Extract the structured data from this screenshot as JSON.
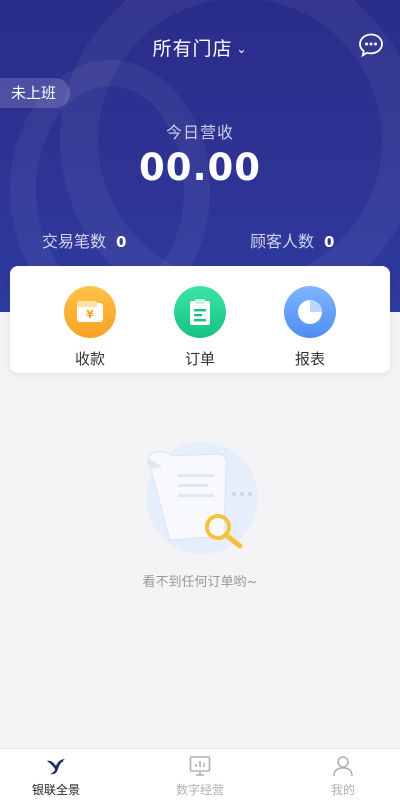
{
  "header": {
    "store_selector": "所有门店",
    "status_badge": "未上班",
    "revenue_label": "今日营收",
    "revenue_value": "00.00",
    "transactions_label": "交易笔数",
    "transactions_value": "0",
    "customers_label": "顾客人数",
    "customers_value": "0"
  },
  "actions": [
    {
      "label": "收款",
      "icon": "wallet-yen-icon"
    },
    {
      "label": "订单",
      "icon": "clipboard-icon"
    },
    {
      "label": "报表",
      "icon": "pie-chart-icon"
    }
  ],
  "empty_state": {
    "message": "看不到任何订单哟~"
  },
  "tabbar": [
    {
      "label": "银联全景",
      "icon": "unionpay-bird-icon",
      "active": true
    },
    {
      "label": "数字经营",
      "icon": "monitor-chart-icon",
      "active": false
    },
    {
      "label": "我的",
      "icon": "user-icon",
      "active": false
    }
  ],
  "colors": {
    "header_bg": "#2e3394",
    "accent_orange": "#f7a224",
    "accent_green": "#18c27f",
    "accent_blue": "#4f8df3"
  }
}
